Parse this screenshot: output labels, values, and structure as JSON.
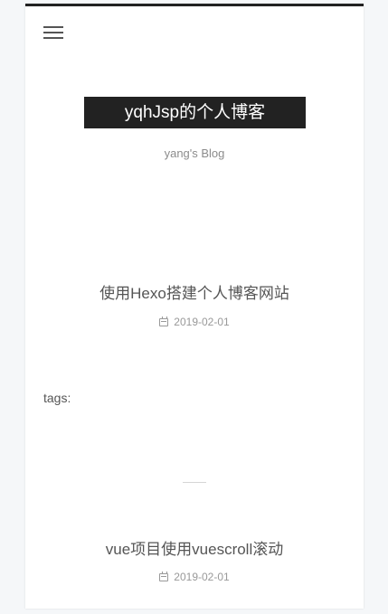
{
  "header": {
    "menu_icon": "menu-icon",
    "site_title": "yqhJsp的个人博客",
    "site_subtitle": "yang's Blog"
  },
  "posts": [
    {
      "title": "使用Hexo搭建个人博客网站",
      "date": "2019-02-01",
      "date_icon": "calendar-icon"
    },
    {
      "title": "vue项目使用vuescroll滚动",
      "date": "2019-02-01",
      "date_icon": "calendar-icon"
    }
  ],
  "tags_label": "tags:",
  "colors": {
    "accent": "#222222",
    "page_background": "#f5f7f9",
    "text": "#555555",
    "muted_text": "#999999"
  }
}
